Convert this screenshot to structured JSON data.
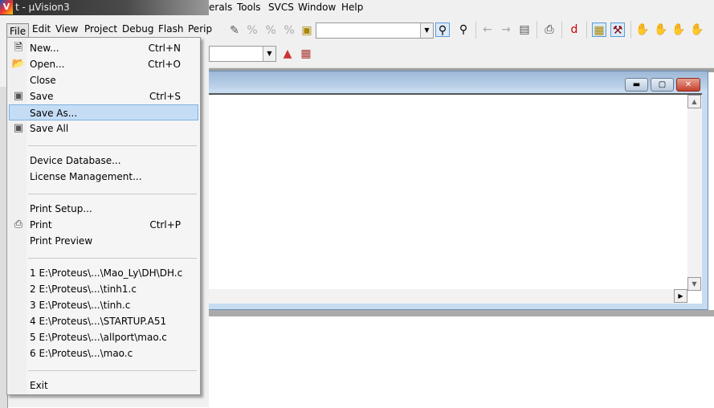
{
  "title": "t  - µVision3",
  "right_menu": [
    "erals",
    "Tools",
    "SVCS",
    "Window",
    "Help"
  ],
  "main_menu": [
    "File",
    "Edit",
    "View",
    "Project",
    "Debug",
    "Flash",
    "Perip"
  ],
  "file_menu": {
    "group1": [
      {
        "label": "New...",
        "shortcut": "Ctrl+N",
        "icon": "new-file-icon"
      },
      {
        "label": "Open...",
        "shortcut": "Ctrl+O",
        "icon": "open-folder-icon"
      },
      {
        "label": "Close",
        "shortcut": ""
      },
      {
        "label": "Save",
        "shortcut": "Ctrl+S",
        "icon": "save-icon"
      },
      {
        "label": "Save As...",
        "shortcut": "",
        "highlighted": true
      },
      {
        "label": "Save All",
        "shortcut": "",
        "icon": "save-all-icon"
      }
    ],
    "group2": [
      {
        "label": "Device Database..."
      },
      {
        "label": "License Management..."
      }
    ],
    "group3": [
      {
        "label": "Print Setup...",
        "shortcut": ""
      },
      {
        "label": "Print",
        "shortcut": "Ctrl+P",
        "icon": "printer-icon"
      },
      {
        "label": "Print Preview",
        "shortcut": ""
      }
    ],
    "recent": [
      "1 E:\\Proteus\\...\\Mao_Ly\\DH\\DH.c",
      "2 E:\\Proteus\\...\\tinh1.c",
      "3 E:\\Proteus\\...\\tinh.c",
      "4 E:\\Proteus\\...\\STARTUP.A51",
      "5 E:\\Proteus\\...\\allport\\mao.c",
      "6 E:\\Proteus\\...\\mao.c"
    ],
    "exit": "Exit"
  },
  "find_combo_value": "",
  "target_combo_value": ""
}
